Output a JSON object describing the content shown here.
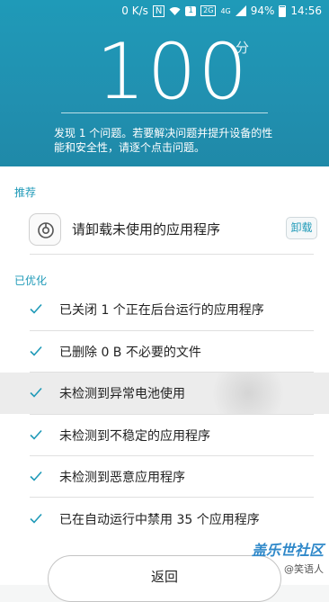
{
  "status_bar": {
    "speed": "0 K/s",
    "nfc": "N",
    "sim_badge": "1",
    "network_badge": "2G",
    "lte": "4G",
    "battery": "94%",
    "time": "14:56"
  },
  "header": {
    "score": "100",
    "score_unit": "分",
    "description": "发现 1 个问题。若要解决问题并提升设备的性能和安全性，请逐个点击问题。"
  },
  "recommend": {
    "label": "推荐",
    "item_text": "请卸载未使用的应用程序",
    "action_label": "卸载"
  },
  "optimized": {
    "label": "已优化",
    "items": [
      "已关闭 1 个正在后台运行的应用程序",
      "已删除 0 B 不必要的文件",
      "未检测到异常电池使用",
      "未检测到不稳定的应用程序",
      "未检测到恶意应用程序",
      "已在自动运行中禁用 35 个应用程序"
    ]
  },
  "footer": {
    "back_label": "返回"
  },
  "watermark": {
    "logo_text": "盖乐世社区",
    "user_text": "@笑语人"
  },
  "colors": {
    "accent": "#1f9ab8",
    "header_bg": "#2190b0"
  }
}
